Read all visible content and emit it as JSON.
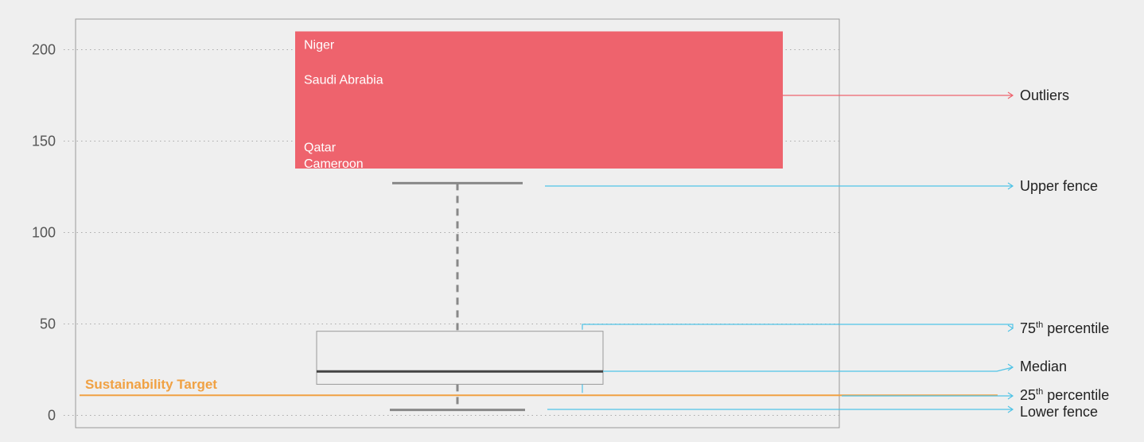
{
  "chart_data": {
    "type": "box",
    "title": "",
    "xlabel": "",
    "ylabel": "",
    "ylim": [
      -7,
      225
    ],
    "yticks": [
      0,
      50,
      100,
      150,
      200
    ],
    "grid": "horizontal dotted",
    "box": {
      "lower_fence": 3,
      "q1": 17,
      "median": 24,
      "q3": 46,
      "upper_fence": 127,
      "outlier_band": [
        135,
        210
      ]
    },
    "outliers": [
      {
        "label": "Niger",
        "value": 203
      },
      {
        "label": "Saudi Abrabia",
        "value": 184
      },
      {
        "label": "Qatar",
        "value": 147
      },
      {
        "label": "Cameroon",
        "value": 138
      }
    ],
    "reference_line": {
      "label": "Sustainability Target",
      "value": 11
    },
    "annotations": [
      {
        "label": "Outliers",
        "sup": ""
      },
      {
        "label": "Upper fence",
        "sup": ""
      },
      {
        "label": " percentile",
        "prefix": "75",
        "sup": "th"
      },
      {
        "label": "Median",
        "sup": ""
      },
      {
        "label": " percentile",
        "prefix": "25",
        "sup": "th"
      },
      {
        "label": "Lower fence",
        "sup": ""
      }
    ],
    "colors": {
      "background": "#efefef",
      "outlier_fill": "#ee636d",
      "annotation_line": "#4fc3e6",
      "outlier_line": "#ee636d",
      "target": "#f0a143",
      "box_stroke": "#999999",
      "median": "#444444",
      "whisker": "#888888",
      "grid": "#aaaaaa"
    }
  }
}
